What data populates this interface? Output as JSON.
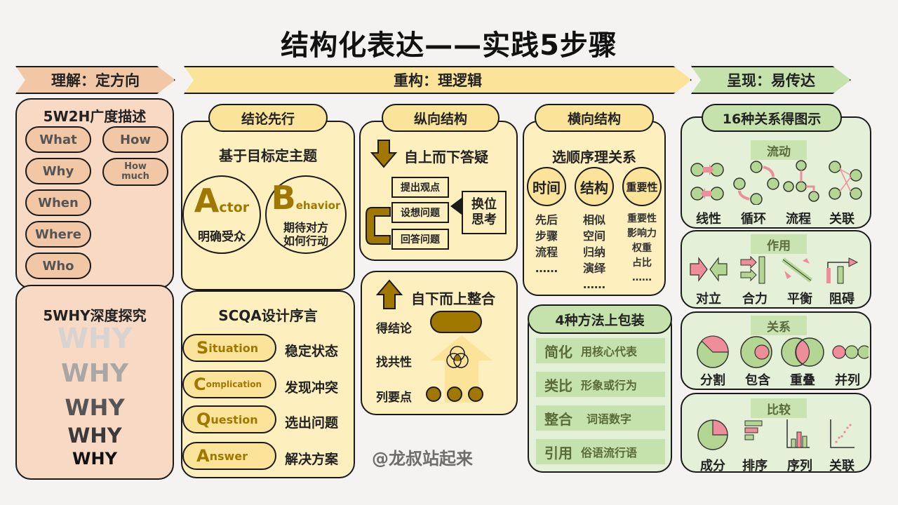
{
  "title": "结构化表达——实践5步骤",
  "steps": {
    "understand": "理解：定方向",
    "restructure": "重构：理逻辑",
    "present": "呈现：易传达"
  },
  "w5h2": {
    "title": "5W2H广度描述",
    "items": [
      "What",
      "Why",
      "When",
      "Where",
      "Who",
      "How",
      "How much"
    ]
  },
  "why5": {
    "title": "5WHY深度探究",
    "whys": [
      "WHY",
      "WHY",
      "WHY",
      "WHY",
      "WHY"
    ]
  },
  "conclusion": {
    "title": "结论先行",
    "subtitle": "基于目标定主题",
    "actor_big": "A",
    "actor_rest": "ctor",
    "actor_desc": "明确受众",
    "behavior_big": "B",
    "behavior_rest": "ehavior",
    "behavior_desc1": "期待对方",
    "behavior_desc2": "如何行动"
  },
  "scqa": {
    "title": "SCQA设计序言",
    "items": [
      {
        "big": "S",
        "rest": "ituation",
        "desc": "稳定状态"
      },
      {
        "big": "C",
        "rest": "omplication",
        "desc": "发现冲突"
      },
      {
        "big": "Q",
        "rest": "uestion",
        "desc": "选出问题"
      },
      {
        "big": "A",
        "rest": "nswer",
        "desc": "解决方案"
      }
    ]
  },
  "vertical": {
    "title": "纵向结构",
    "top_down": "自上而下答疑",
    "boxes": [
      "提出观点",
      "设想问题",
      "回答问题"
    ],
    "swap": "换位思考",
    "bottom_up": "自下而上整合",
    "labels": [
      "得结论",
      "找共性",
      "列要点"
    ]
  },
  "horizontal": {
    "title": "横向结构",
    "subtitle": "选顺序理关系",
    "circles": [
      "时间",
      "结构",
      "重要性"
    ],
    "col1": [
      "先后",
      "步骤",
      "流程",
      "……"
    ],
    "col2": [
      "相似",
      "空间",
      "归纳",
      "演绎",
      "……"
    ],
    "col3": [
      "重要性",
      "影响力",
      "权重",
      "占比",
      "……"
    ]
  },
  "packaging": {
    "title": "4种方法上包装",
    "rows": [
      {
        "key": "简化",
        "val": "用核心代表"
      },
      {
        "key": "类比",
        "val": "形象或行为"
      },
      {
        "key": "整合",
        "val": "词语数字"
      },
      {
        "key": "引用",
        "val": "俗语流行语"
      }
    ]
  },
  "watermark": "@龙叔站起来",
  "relations": {
    "title": "16种关系得图示",
    "groups": [
      {
        "name": "流动",
        "items": [
          "线性",
          "循环",
          "流程",
          "关联"
        ]
      },
      {
        "name": "作用",
        "items": [
          "对立",
          "合力",
          "平衡",
          "阻碍"
        ]
      },
      {
        "name": "关系",
        "items": [
          "分割",
          "包含",
          "重叠",
          "并列"
        ]
      },
      {
        "name": "比较",
        "items": [
          "成分",
          "排序",
          "序列",
          "关联"
        ]
      }
    ]
  },
  "colors": {
    "peach": "#f7d9c4",
    "yellow": "#fdefbe",
    "olive": "#a07800",
    "green": "#e4f0d8",
    "pink": "#ee8e9b"
  }
}
